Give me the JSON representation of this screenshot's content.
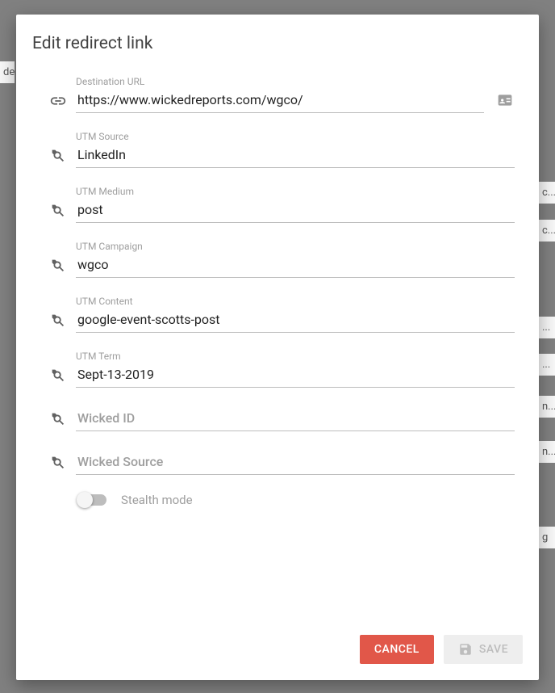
{
  "dialog": {
    "title": "Edit redirect link"
  },
  "fields": {
    "destination_url": {
      "label": "Destination URL",
      "value": "https://www.wickedreports.com/wgco/"
    },
    "utm_source": {
      "label": "UTM Source",
      "value": "LinkedIn"
    },
    "utm_medium": {
      "label": "UTM Medium",
      "value": "post"
    },
    "utm_campaign": {
      "label": "UTM Campaign",
      "value": "wgco"
    },
    "utm_content": {
      "label": "UTM Content",
      "value": "google-event-scotts-post"
    },
    "utm_term": {
      "label": "UTM Term",
      "value": "Sept-13-2019"
    },
    "wicked_id": {
      "placeholder": "Wicked ID",
      "value": ""
    },
    "wicked_source": {
      "placeholder": "Wicked Source",
      "value": ""
    }
  },
  "toggle": {
    "stealth_label": "Stealth mode",
    "stealth_on": false
  },
  "actions": {
    "cancel": "CANCEL",
    "save": "SAVE"
  },
  "bg_rows": [
    "de",
    "c...",
    "c...",
    "...",
    "...",
    "n...",
    "n...",
    "g"
  ]
}
